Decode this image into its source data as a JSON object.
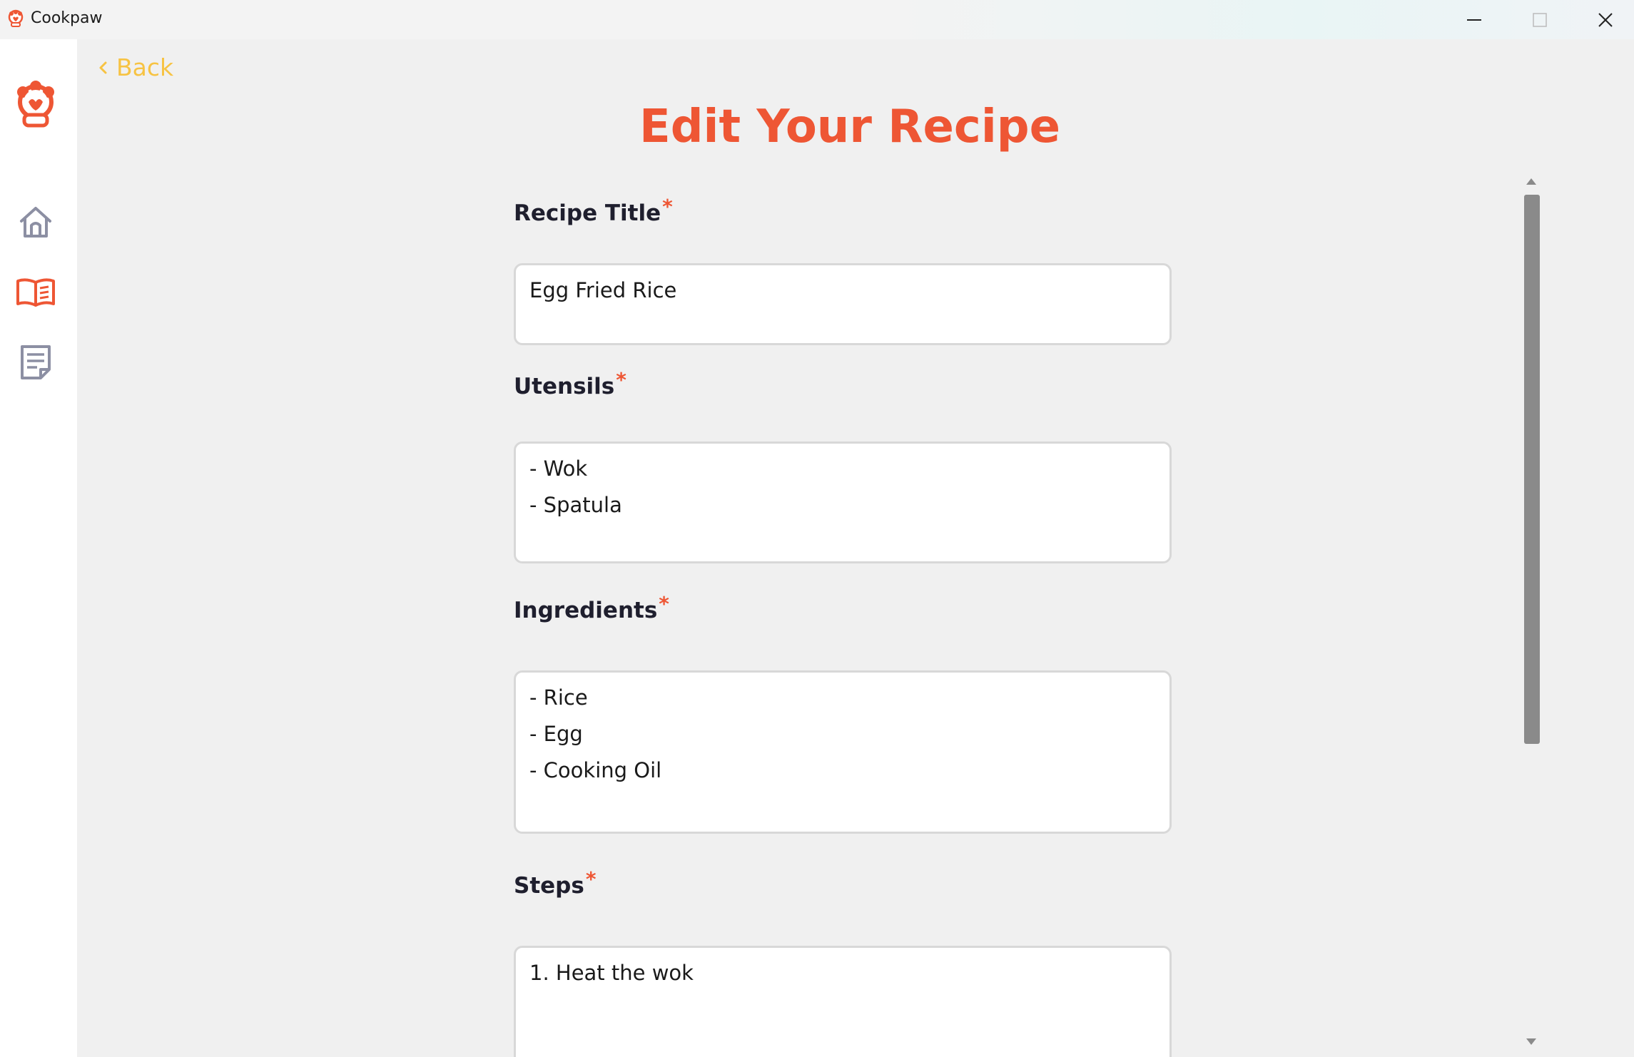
{
  "window": {
    "app_name": "Cookpaw",
    "controls": [
      "minimize",
      "maximize",
      "close"
    ]
  },
  "sidebar": {
    "logo_icon": "paw-chef-hat-icon",
    "items": [
      {
        "id": "home",
        "icon": "home-icon",
        "active": false
      },
      {
        "id": "recipes",
        "icon": "open-book-icon",
        "active": true
      },
      {
        "id": "notes",
        "icon": "notepad-icon",
        "active": false
      }
    ]
  },
  "header": {
    "back_label": "Back",
    "title": "Edit Your Recipe"
  },
  "form": {
    "required_mark": "*",
    "recipe_title": {
      "label": "Recipe Title",
      "value": "Egg Fried Rice"
    },
    "utensils": {
      "label": "Utensils",
      "lines": [
        "- Wok",
        "- Spatula"
      ]
    },
    "ingredients": {
      "label": "Ingredients",
      "lines": [
        "- Rice",
        "- Egg",
        "- Cooking Oil"
      ]
    },
    "steps": {
      "label": "Steps",
      "lines": [
        "1. Heat the wok"
      ]
    }
  },
  "colors": {
    "accent": "#ee5634",
    "back": "#f7c343",
    "label": "#1f1f2e",
    "nav_inactive": "#8c8fa3"
  }
}
